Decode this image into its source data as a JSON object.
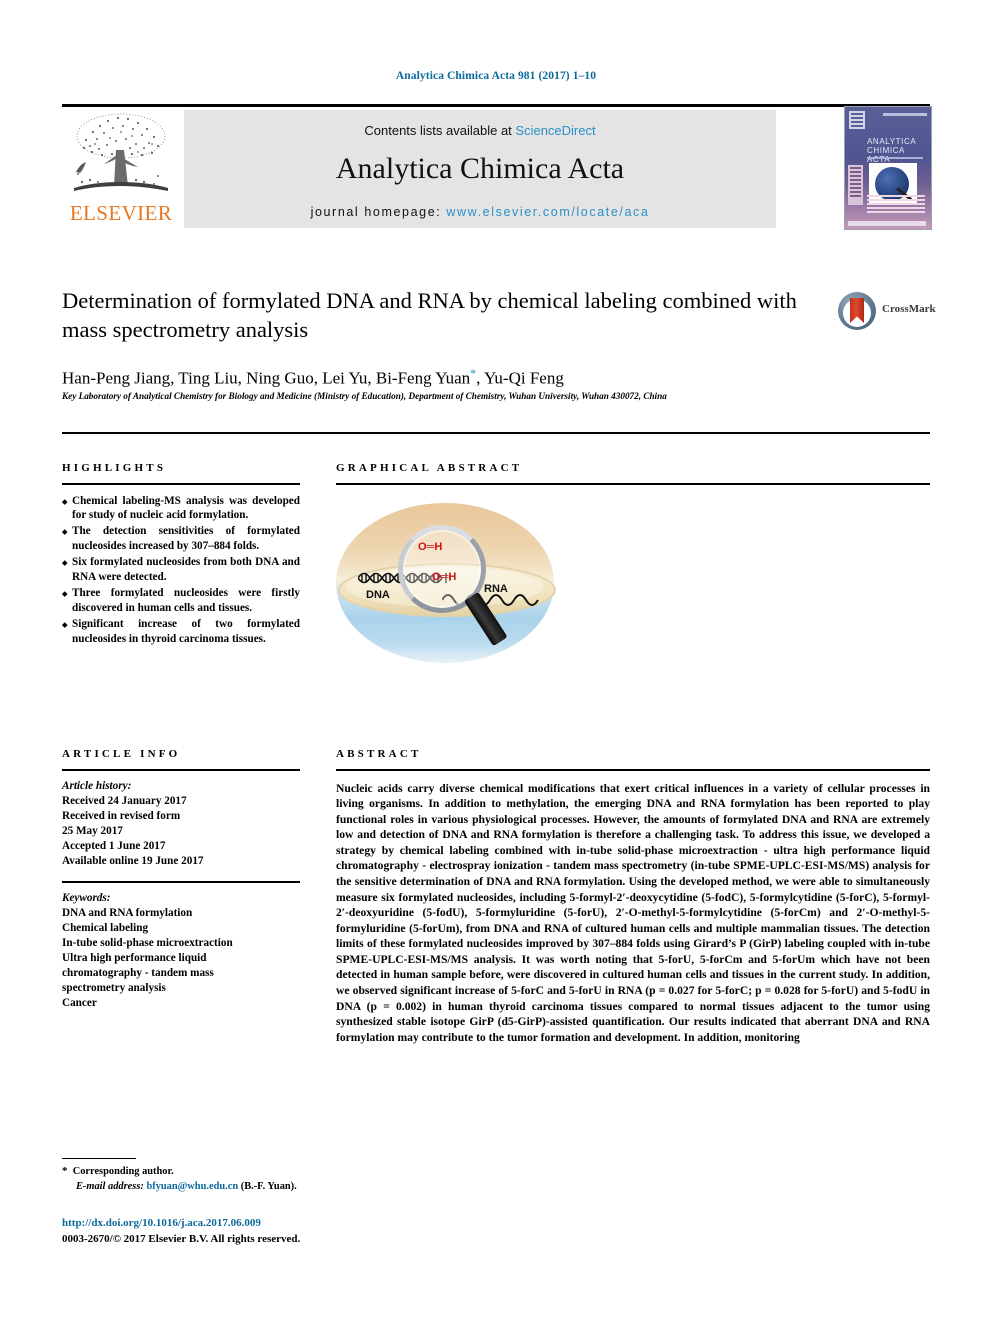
{
  "running_head": "Analytica Chimica Acta 981 (2017) 1–10",
  "masthead": {
    "publisher": "ELSEVIER",
    "contents_prefix": "Contents lists available at ",
    "contents_link": "ScienceDirect",
    "journal_name": "Analytica Chimica Acta",
    "homepage_prefix": "journal homepage: ",
    "homepage_url": "www.elsevier.com/locate/aca",
    "cover_title_line1": "ANALYTICA",
    "cover_title_line2": "CHIMICA ACTA"
  },
  "crossmark": {
    "label": "CrossMark"
  },
  "title": "Determination of formylated DNA and RNA by chemical labeling combined with mass spectrometry analysis",
  "authors": "Han-Peng Jiang, Ting Liu, Ning Guo, Lei Yu, Bi-Feng Yuan",
  "authors_tail": ", Yu-Qi Feng",
  "affiliation": "Key Laboratory of Analytical Chemistry for Biology and Medicine (Ministry of Education), Department of Chemistry, Wuhan University, Wuhan 430072, China",
  "highlights": {
    "heading": "HIGHLIGHTS",
    "items": [
      "Chemical labeling-MS analysis was developed for study of nucleic acid formylation.",
      "The detection sensitivities of formylated nucleosides increased by 307–884 folds.",
      "Six formylated nucleosides from both DNA and RNA were detected.",
      "Three formylated nucleosides were firstly discovered in human cells and tissues.",
      "Significant increase of two formylated nucleosides in thyroid carcinoma tissues."
    ]
  },
  "graphical_abstract": {
    "heading": "GRAPHICAL ABSTRACT",
    "label_dna": "DNA",
    "label_rna": "RNA",
    "formyl_top": "O═H",
    "formyl_bottom": "O═H",
    "colors": {
      "bowl_top": "#e9c79a",
      "bowl_bottom": "#a9d3ea",
      "formyl": "#d01414"
    }
  },
  "article_info": {
    "heading": "ARTICLE INFO",
    "history_label": "Article history:",
    "history": [
      "Received 24 January 2017",
      "Received in revised form",
      "25 May 2017",
      "Accepted 1 June 2017",
      "Available online 19 June 2017"
    ],
    "keywords_label": "Keywords:",
    "keywords": [
      "DNA and RNA formylation",
      "Chemical labeling",
      "In-tube solid-phase microextraction",
      "Ultra high performance liquid",
      "chromatography - tandem mass",
      "spectrometry analysis",
      "Cancer"
    ]
  },
  "abstract": {
    "heading": "ABSTRACT",
    "paragraphs": [
      "Nucleic acids carry diverse chemical modifications that exert critical influences in a variety of cellular processes in living organisms. In addition to methylation, the emerging DNA and RNA formylation has been reported to play functional roles in various physiological processes. However, the amounts of formylated DNA and RNA are extremely low and detection of DNA and RNA formylation is therefore a challenging task. To address this issue, we developed a strategy by chemical labeling combined with in-tube solid-phase microextraction - ultra high performance liquid chromatography - electrospray ionization - tandem mass spectrometry (in-tube SPME-UPLC-ESI-MS/MS) analysis for the sensitive determination of DNA and RNA formylation. Using the developed method, we were able to simultaneously measure six formylated nucleosides, including 5-formyl-2′-deoxycytidine (5-fodC), 5-formylcytidine (5-forC), 5-formyl-2′-deoxyuridine (5-fodU), 5-formyluridine (5-forU), 2′-O-methyl-5-formylcytidine (5-forCm) and 2′-O-methyl-5- formyluridine (5-forUm), from DNA and RNA of cultured human cells and multiple mammalian tissues. The detection limits of these formylated nucleosides improved by 307–884 folds using Girard’s P (GirP) labeling coupled with in-tube SPME-UPLC-ESI-MS/MS analysis. It was worth noting that 5-forU, 5-forCm and 5-forUm which have not been detected in human sample before, were discovered in cultured human cells and tissues in the current study. In addition, we observed significant increase of 5-forC and 5-forU in RNA (p = 0.027 for 5-forC; p = 0.028 for 5-forU) and 5-fodU in DNA (p = 0.002) in human thyroid carcinoma tissues compared to normal tissues adjacent to the tumor using synthesized stable isotope GirP (d5-GirP)-assisted quantification. Our results indicated that aberrant DNA and RNA formylation may contribute to the tumor formation and development. In addition, monitoring"
    ]
  },
  "footnote": {
    "corresponding": "Corresponding author.",
    "email_label": "E-mail address:",
    "email": "bfyuan@whu.edu.cn",
    "email_owner": "(B.-F. Yuan)."
  },
  "footer": {
    "doi": "http://dx.doi.org/10.1016/j.aca.2017.06.009",
    "copyright": "0003-2670/© 2017 Elsevier B.V. All rights reserved."
  }
}
